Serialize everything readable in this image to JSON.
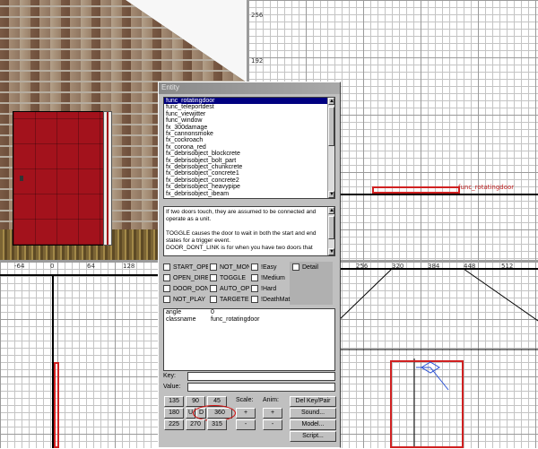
{
  "viewports": {
    "top_right": {
      "axis_labels": [
        "256",
        "192"
      ]
    },
    "top_right_entity_label": "func_rotatingdoor",
    "side_axis_labels": [
      "-64",
      "0",
      "64",
      "128",
      "256",
      "320",
      "384",
      "448",
      "512"
    ]
  },
  "dialog": {
    "title": "Entity",
    "class_list": [
      "func_rotatingdoor",
      "func_teleportdest",
      "func_viewjitter",
      "func_window",
      "fx_300damage",
      "fx_cannonsmoke",
      "fx_cockroach",
      "fx_corona_red",
      "fx_debrisobject_blockcrete",
      "fx_debrisobject_bolt_part",
      "fx_debrisobject_chunkcrete",
      "fx_debrisobject_concrete1",
      "fx_debrisobject_concrete2",
      "fx_debrisobject_heavypipe",
      "fx_debrisobject_ibeam"
    ],
    "selected_index": 0,
    "description": [
      "If two doors touch, they are assumed to be connected and operate as a unit.",
      "",
      "TOGGLE causes the door to wait in both the start and end states for a trigger event.",
      "DOOR_DONT_LINK is for when you have two doors that"
    ],
    "flags": [
      {
        "label": "START_OPE",
        "col": 0,
        "row": 0
      },
      {
        "label": "NOT_MONS",
        "col": 1,
        "row": 0
      },
      {
        "label": "!Easy",
        "col": 2,
        "row": 0
      },
      {
        "label": "Detail",
        "col": 3,
        "row": 0
      },
      {
        "label": "OPEN_DIRE",
        "col": 0,
        "row": 1
      },
      {
        "label": "TOGGLE",
        "col": 1,
        "row": 1
      },
      {
        "label": "!Medium",
        "col": 2,
        "row": 1
      },
      {
        "label": "DOOR_DON",
        "col": 0,
        "row": 2
      },
      {
        "label": "AUTO_OPE",
        "col": 1,
        "row": 2
      },
      {
        "label": "!Hard",
        "col": 2,
        "row": 2
      },
      {
        "label": "NOT_PLAY",
        "col": 0,
        "row": 3
      },
      {
        "label": "TARGETED",
        "col": 1,
        "row": 3
      },
      {
        "label": "!DeathMat",
        "col": 2,
        "row": 3
      }
    ],
    "keyvalues": [
      {
        "key": "angle",
        "value": "0"
      },
      {
        "key": "classname",
        "value": "func_rotatingdoor"
      }
    ],
    "key_label": "Key:",
    "value_label": "Value:",
    "key_value": "",
    "value_value": "",
    "angle_buttons": [
      [
        "135",
        "90",
        "45"
      ],
      [
        "180",
        "U",
        "D",
        "360"
      ],
      [
        "225",
        "270",
        "315"
      ]
    ],
    "scale_label": "Scale:",
    "anim_label": "Anim:",
    "plus": "+",
    "minus": "-",
    "right_buttons": [
      "Del Key/Pair",
      "Sound...",
      "Model...",
      "Script..."
    ]
  }
}
